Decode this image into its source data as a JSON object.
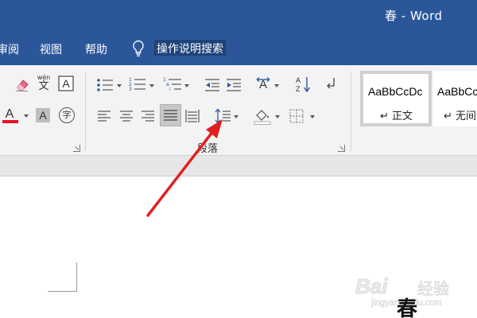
{
  "window": {
    "title": "春 - Word"
  },
  "menu": {
    "items": [
      "审阅",
      "视图",
      "帮助"
    ],
    "tell_me": "操作说明搜索"
  },
  "ribbon": {
    "paragraph_group_label": "段落",
    "font_glyphs": {
      "phonetic_top": "wén",
      "phonetic_bottom": "文",
      "enclose": "字"
    },
    "styles": [
      {
        "sample": "AaBbCcDc",
        "name": "↵ 正文"
      },
      {
        "sample": "AaBbCcDc",
        "name": "↵ 无间"
      }
    ]
  },
  "document": {
    "text": "春"
  },
  "watermark": {
    "brand": "Bai",
    "brand_cn": "经验",
    "url": "jingyan.baidu.com"
  },
  "colors": {
    "titlebar": "#2b579a",
    "annotation_arrow": "#e02020",
    "font_color_bar": "#e81123"
  },
  "icons": [
    "eraser-icon",
    "phonetic-guide-icon",
    "char-border-icon",
    "font-color-icon",
    "char-shading-icon",
    "enclose-char-icon",
    "bullets-icon",
    "numbering-icon",
    "multilevel-list-icon",
    "decrease-indent-icon",
    "increase-indent-icon",
    "sort-icon",
    "show-marks-icon",
    "align-left-icon",
    "center-icon",
    "align-right-icon",
    "justify-icon",
    "distributed-icon",
    "line-spacing-icon",
    "shading-icon",
    "borders-icon",
    "lightbulb-icon"
  ]
}
